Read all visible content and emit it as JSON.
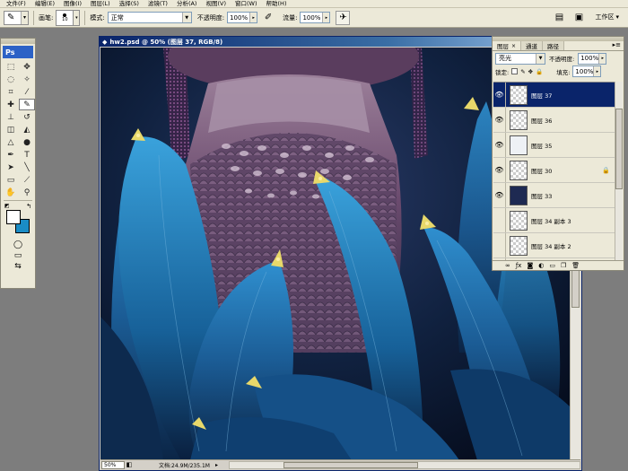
{
  "menu": [
    "文件(F)",
    "编辑(E)",
    "图像(I)",
    "图层(L)",
    "选择(S)",
    "滤镜(T)",
    "分析(A)",
    "视图(V)",
    "窗口(W)",
    "帮助(H)"
  ],
  "options": {
    "brush_label": "画笔:",
    "brush_size": "10",
    "mode_label": "模式:",
    "mode_value": "正常",
    "opacity_label": "不透明度:",
    "opacity_value": "100%",
    "flow_label": "流量:",
    "flow_value": "100%",
    "workspace_label": "工作区"
  },
  "toolbox": {
    "logo": "Ps",
    "fg_color": "#ffffff",
    "bg_color": "#1a8cc5"
  },
  "document": {
    "title": "hw2.psd @ 50% (图层 37, RGB/8)",
    "zoom": "50%",
    "doc_info": "文档:24.9M/235.1M"
  },
  "layers_panel": {
    "tabs": [
      "图层",
      "通道",
      "路径"
    ],
    "blend_mode": "亮光",
    "opacity_label": "不透明度:",
    "opacity_value": "100%",
    "lock_label": "锁定:",
    "fill_label": "填充:",
    "fill_value": "100%",
    "layers": [
      {
        "name": "图层 37",
        "visible": true,
        "selected": true,
        "locked": false,
        "thumb": "checker"
      },
      {
        "name": "图层 36",
        "visible": true,
        "selected": false,
        "locked": false,
        "thumb": "checker"
      },
      {
        "name": "图层 35",
        "visible": true,
        "selected": false,
        "locked": false,
        "thumb": "sketch"
      },
      {
        "name": "图层 30",
        "visible": true,
        "selected": false,
        "locked": true,
        "thumb": "checker"
      },
      {
        "name": "图层 33",
        "visible": true,
        "selected": false,
        "locked": false,
        "thumb": "dark"
      },
      {
        "name": "图层 34 副本 3",
        "visible": false,
        "selected": false,
        "locked": false,
        "thumb": "checker"
      },
      {
        "name": "图层 34 副本 2",
        "visible": false,
        "selected": false,
        "locked": false,
        "thumb": "checker"
      },
      {
        "name": "",
        "visible": false,
        "selected": false,
        "locked": false,
        "thumb": "dark"
      }
    ]
  }
}
